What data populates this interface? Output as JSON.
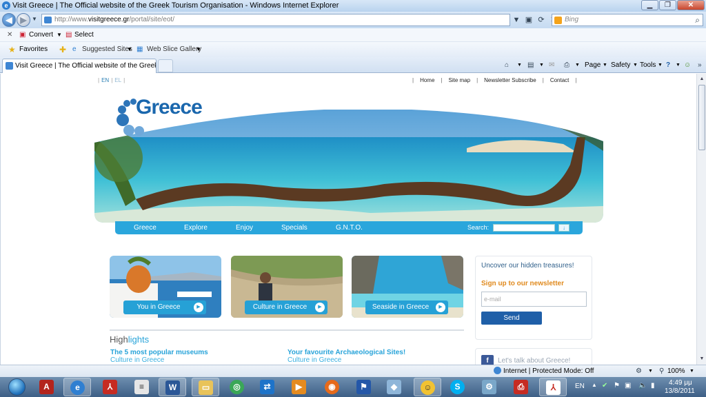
{
  "window": {
    "title": "Visit Greece | The Official website of the Greek Tourism Organisation - Windows Internet Explorer"
  },
  "address": {
    "url_prefix": "http://www.",
    "url_domain": "visitgreece.gr",
    "url_path": "/portal/site/eot/",
    "search_placeholder": "Bing"
  },
  "commandbar": {
    "convert": "Convert",
    "select": "Select",
    "favorites": "Favorites",
    "suggested_sites": "Suggested Sites",
    "web_slice_gallery": "Web Slice Gallery"
  },
  "tab": {
    "label": "Visit Greece | The Official website of the Greek To..."
  },
  "tabtools": {
    "page": "Page",
    "safety": "Safety",
    "tools": "Tools"
  },
  "site": {
    "lang_en": "EN",
    "lang_el": "EL",
    "topnav": [
      "Home",
      "Site map",
      "Newsletter Subscribe",
      "Contact"
    ],
    "logo_text": "Greece",
    "menu": [
      "Greece",
      "Explore",
      "Enjoy",
      "Specials",
      "G.N.T.O."
    ],
    "search_label": "Search:",
    "cards": [
      "You in Greece",
      "Culture in Greece",
      "Seaside in Greece"
    ],
    "highlights_prefix": "High",
    "highlights_suffix": "lights",
    "highlight_items": [
      {
        "title": "The 5 most popular museums",
        "category": "Culture in Greece"
      },
      {
        "title": "Your favourite Archaeological Sites!",
        "category": "Culture in Greece"
      }
    ],
    "newsletter": {
      "headline": "Uncover our hidden treasures!",
      "signup": "Sign up to our newsletter",
      "email_placeholder": "e-mail",
      "send": "Send"
    },
    "social": "Let's talk about Greece!"
  },
  "statusbar": {
    "zone": "Internet | Protected Mode: Off",
    "zoom": "100%"
  },
  "tray": {
    "lang": "EN",
    "time": "4:49 μμ",
    "date": "13/8/2011"
  },
  "colors": {
    "site_blue": "#2aa6dc",
    "logo_blue": "#1a67ad",
    "orange": "#e08a1e",
    "send_button": "#1f5fa8"
  }
}
